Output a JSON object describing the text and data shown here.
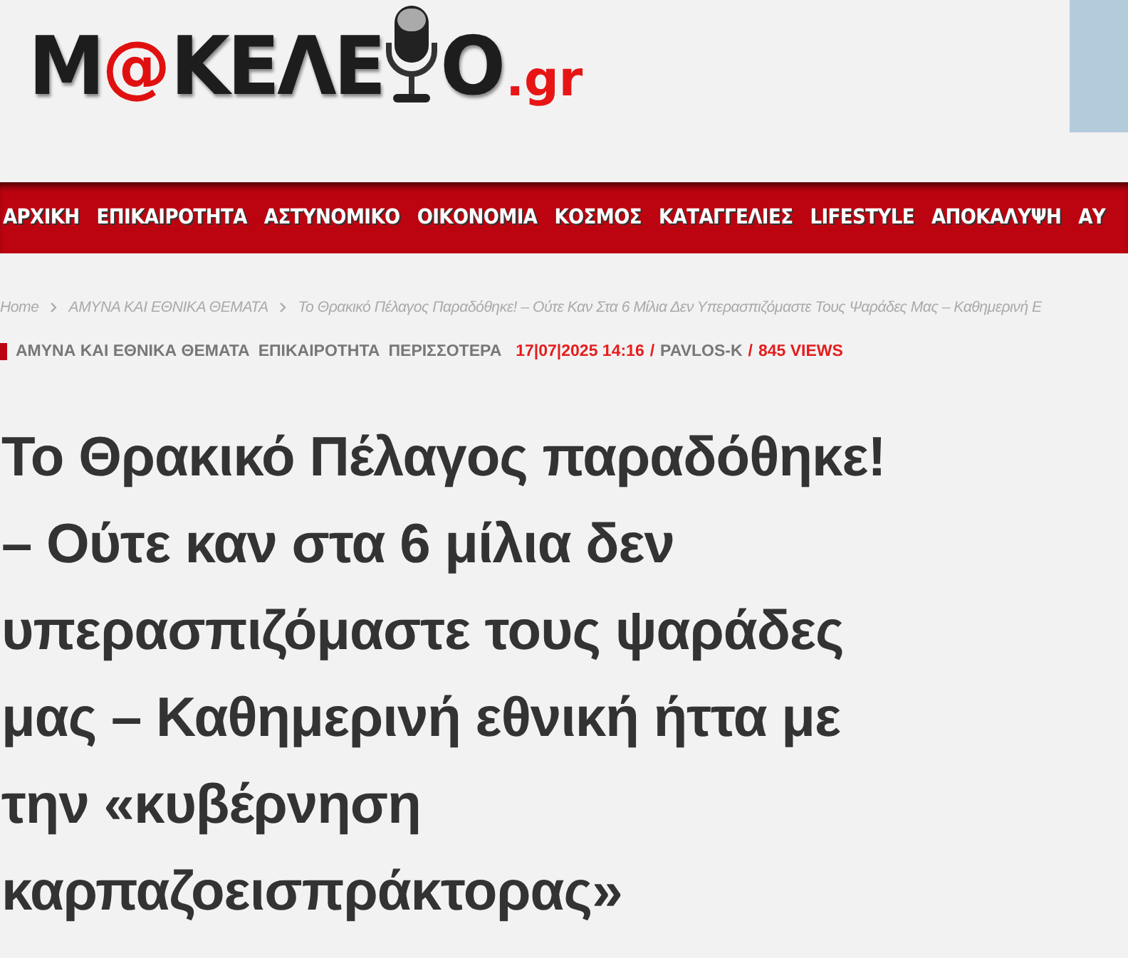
{
  "logo": {
    "first": "M",
    "at": "@",
    "middle": "ΚΕΛΕ",
    "last": "O",
    "suffix": ".gr"
  },
  "nav": [
    "ΑΡΧΙΚΗ",
    "ΕΠΙΚΑΙΡΟΤΗΤΑ",
    "ΑΣΤΥΝΟΜΙΚΟ",
    "ΟΙΚΟΝΟΜΙΑ",
    "ΚΟΣΜΟΣ",
    "ΚΑΤΑΓΓΕΛΙΕΣ",
    "LIFESTYLE",
    "ΑΠΟΚΑΛΥΨΗ",
    "ΑΥ"
  ],
  "breadcrumb": [
    {
      "label": "Home"
    },
    {
      "label": "ΑΜΥΝΑ ΚΑΙ ΕΘΝΙΚΑ ΘΕΜΑΤΑ"
    },
    {
      "label": "Το Θρακικό Πέλαγος Παραδόθηκε! – Ούτε Καν Στα 6 Μίλια Δεν Υπερασπιζόμαστε Τους Ψαράδες Μας – Καθημερινή Ε"
    }
  ],
  "meta": {
    "categories": [
      "ΑΜΥΝΑ ΚΑΙ ΕΘΝΙΚΑ ΘΕΜΑΤΑ",
      "ΕΠΙΚΑΙΡΟΤΗΤΑ",
      "ΠΕΡΙΣΣΟΤΕΡΑ"
    ],
    "date": "17|07|2025 14:16",
    "author": "PAVLOS-K",
    "separator": "/",
    "views": "845 VIEWS"
  },
  "title_lines": [
    "Το Θρακικό Πέλαγος παραδόθηκε!",
    "– Ούτε καν στα 6 μίλια δεν",
    "υπερασπιζόμαστε τους ψαράδες",
    "μας – Καθημερινή εθνική ήττα με",
    "την «κυβέρνηση",
    "καρπαζοεισπράκτορας»"
  ]
}
